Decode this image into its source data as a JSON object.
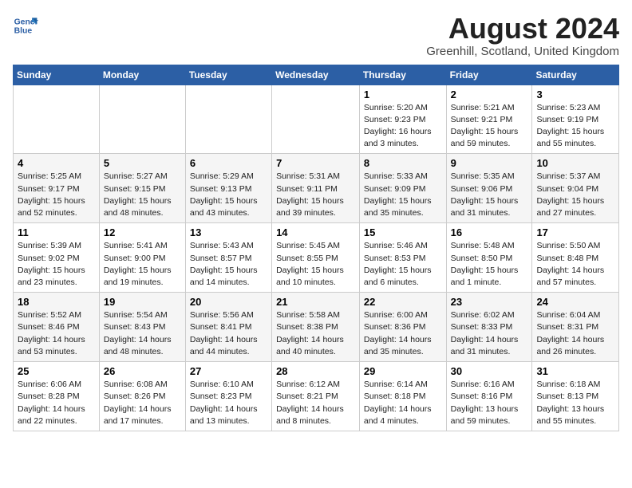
{
  "header": {
    "logo_line1": "General",
    "logo_line2": "Blue",
    "month_year": "August 2024",
    "location": "Greenhill, Scotland, United Kingdom"
  },
  "days_of_week": [
    "Sunday",
    "Monday",
    "Tuesday",
    "Wednesday",
    "Thursday",
    "Friday",
    "Saturday"
  ],
  "weeks": [
    [
      {
        "day": "",
        "info": ""
      },
      {
        "day": "",
        "info": ""
      },
      {
        "day": "",
        "info": ""
      },
      {
        "day": "",
        "info": ""
      },
      {
        "day": "1",
        "info": "Sunrise: 5:20 AM\nSunset: 9:23 PM\nDaylight: 16 hours\nand 3 minutes."
      },
      {
        "day": "2",
        "info": "Sunrise: 5:21 AM\nSunset: 9:21 PM\nDaylight: 15 hours\nand 59 minutes."
      },
      {
        "day": "3",
        "info": "Sunrise: 5:23 AM\nSunset: 9:19 PM\nDaylight: 15 hours\nand 55 minutes."
      }
    ],
    [
      {
        "day": "4",
        "info": "Sunrise: 5:25 AM\nSunset: 9:17 PM\nDaylight: 15 hours\nand 52 minutes."
      },
      {
        "day": "5",
        "info": "Sunrise: 5:27 AM\nSunset: 9:15 PM\nDaylight: 15 hours\nand 48 minutes."
      },
      {
        "day": "6",
        "info": "Sunrise: 5:29 AM\nSunset: 9:13 PM\nDaylight: 15 hours\nand 43 minutes."
      },
      {
        "day": "7",
        "info": "Sunrise: 5:31 AM\nSunset: 9:11 PM\nDaylight: 15 hours\nand 39 minutes."
      },
      {
        "day": "8",
        "info": "Sunrise: 5:33 AM\nSunset: 9:09 PM\nDaylight: 15 hours\nand 35 minutes."
      },
      {
        "day": "9",
        "info": "Sunrise: 5:35 AM\nSunset: 9:06 PM\nDaylight: 15 hours\nand 31 minutes."
      },
      {
        "day": "10",
        "info": "Sunrise: 5:37 AM\nSunset: 9:04 PM\nDaylight: 15 hours\nand 27 minutes."
      }
    ],
    [
      {
        "day": "11",
        "info": "Sunrise: 5:39 AM\nSunset: 9:02 PM\nDaylight: 15 hours\nand 23 minutes."
      },
      {
        "day": "12",
        "info": "Sunrise: 5:41 AM\nSunset: 9:00 PM\nDaylight: 15 hours\nand 19 minutes."
      },
      {
        "day": "13",
        "info": "Sunrise: 5:43 AM\nSunset: 8:57 PM\nDaylight: 15 hours\nand 14 minutes."
      },
      {
        "day": "14",
        "info": "Sunrise: 5:45 AM\nSunset: 8:55 PM\nDaylight: 15 hours\nand 10 minutes."
      },
      {
        "day": "15",
        "info": "Sunrise: 5:46 AM\nSunset: 8:53 PM\nDaylight: 15 hours\nand 6 minutes."
      },
      {
        "day": "16",
        "info": "Sunrise: 5:48 AM\nSunset: 8:50 PM\nDaylight: 15 hours\nand 1 minute."
      },
      {
        "day": "17",
        "info": "Sunrise: 5:50 AM\nSunset: 8:48 PM\nDaylight: 14 hours\nand 57 minutes."
      }
    ],
    [
      {
        "day": "18",
        "info": "Sunrise: 5:52 AM\nSunset: 8:46 PM\nDaylight: 14 hours\nand 53 minutes."
      },
      {
        "day": "19",
        "info": "Sunrise: 5:54 AM\nSunset: 8:43 PM\nDaylight: 14 hours\nand 48 minutes."
      },
      {
        "day": "20",
        "info": "Sunrise: 5:56 AM\nSunset: 8:41 PM\nDaylight: 14 hours\nand 44 minutes."
      },
      {
        "day": "21",
        "info": "Sunrise: 5:58 AM\nSunset: 8:38 PM\nDaylight: 14 hours\nand 40 minutes."
      },
      {
        "day": "22",
        "info": "Sunrise: 6:00 AM\nSunset: 8:36 PM\nDaylight: 14 hours\nand 35 minutes."
      },
      {
        "day": "23",
        "info": "Sunrise: 6:02 AM\nSunset: 8:33 PM\nDaylight: 14 hours\nand 31 minutes."
      },
      {
        "day": "24",
        "info": "Sunrise: 6:04 AM\nSunset: 8:31 PM\nDaylight: 14 hours\nand 26 minutes."
      }
    ],
    [
      {
        "day": "25",
        "info": "Sunrise: 6:06 AM\nSunset: 8:28 PM\nDaylight: 14 hours\nand 22 minutes."
      },
      {
        "day": "26",
        "info": "Sunrise: 6:08 AM\nSunset: 8:26 PM\nDaylight: 14 hours\nand 17 minutes."
      },
      {
        "day": "27",
        "info": "Sunrise: 6:10 AM\nSunset: 8:23 PM\nDaylight: 14 hours\nand 13 minutes."
      },
      {
        "day": "28",
        "info": "Sunrise: 6:12 AM\nSunset: 8:21 PM\nDaylight: 14 hours\nand 8 minutes."
      },
      {
        "day": "29",
        "info": "Sunrise: 6:14 AM\nSunset: 8:18 PM\nDaylight: 14 hours\nand 4 minutes."
      },
      {
        "day": "30",
        "info": "Sunrise: 6:16 AM\nSunset: 8:16 PM\nDaylight: 13 hours\nand 59 minutes."
      },
      {
        "day": "31",
        "info": "Sunrise: 6:18 AM\nSunset: 8:13 PM\nDaylight: 13 hours\nand 55 minutes."
      }
    ]
  ]
}
